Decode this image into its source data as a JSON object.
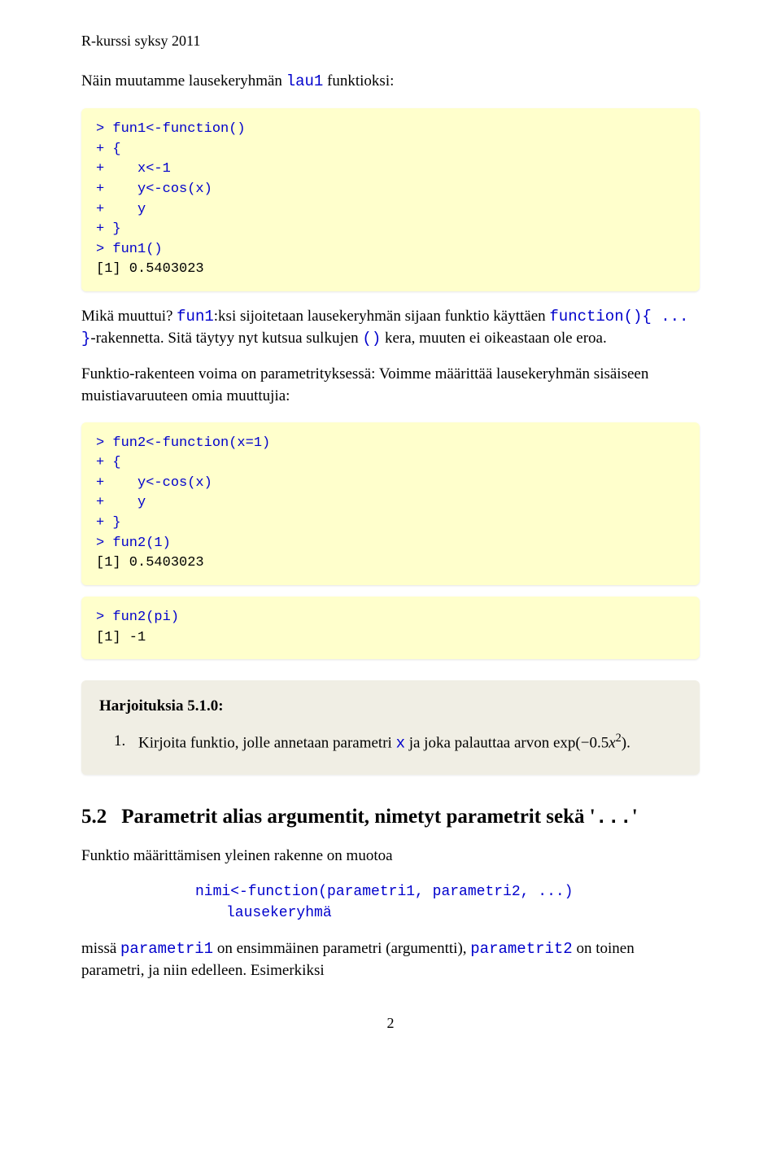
{
  "header": "R-kurssi syksy 2011",
  "intro": {
    "prefix": "Näin muutamme lausekeryhmän ",
    "code": "lau1",
    "suffix": " funktioksi:"
  },
  "code1": {
    "l1": "> fun1<-function()",
    "l2": "+ {",
    "l3": "+    x<-1",
    "l4": "+    y<-cos(x)",
    "l5": "+    y",
    "l6": "+ }",
    "l7": "> fun1()",
    "out": "[1] 0.5403023"
  },
  "para1": {
    "a": "Mikä muuttui? ",
    "b": "fun1",
    "c": ":ksi sijoitetaan lausekeryhmän sijaan funktio käyttäen ",
    "d": "function(){ ... }",
    "e": "-rakennetta. Sitä täytyy nyt kutsua sulkujen ",
    "f": "()",
    "g": " kera, muuten ei oikeastaan ole eroa."
  },
  "para2": "Funktio-rakenteen voima on parametrityksessä: Voimme määrittää lausekeryhmän sisäiseen muistiavaruuteen omia muuttujia:",
  "code2": {
    "l1": "> fun2<-function(x=1)",
    "l2": "+ {",
    "l3": "+    y<-cos(x)",
    "l4": "+    y",
    "l5": "+ }",
    "l6": "> fun2(1)",
    "out": "[1] 0.5403023"
  },
  "code3": {
    "l1": "> fun2(pi)",
    "out": "[1] -1"
  },
  "exercise": {
    "title": "Harjoituksia 5.1.0:",
    "num": "1.",
    "pre": "Kirjoita funktio, jolle annetaan parametri ",
    "codeX": "x",
    "mid": " ja joka palauttaa arvon exp(−0.5",
    "xsym": "x",
    "sup": "2",
    "post": ")."
  },
  "section": {
    "num": "5.2",
    "title": "Parametrit alias argumentit, nimetyt parametrit sekä '",
    "dots": "...",
    "close": "'"
  },
  "para3": "Funktio määrittämisen yleinen rakenne on muotoa",
  "syntax": {
    "l1": "nimi<-function(parametri1, parametri2, ...)",
    "l2": "lausekeryhmä"
  },
  "para4": {
    "a": "missä ",
    "b": "parametri1",
    "c": " on ensimmäinen parametri (argumentti), ",
    "d": "parametrit2",
    "e": " on toinen parametri, ja niin edelleen. Esimerkiksi"
  },
  "pagenum": "2"
}
